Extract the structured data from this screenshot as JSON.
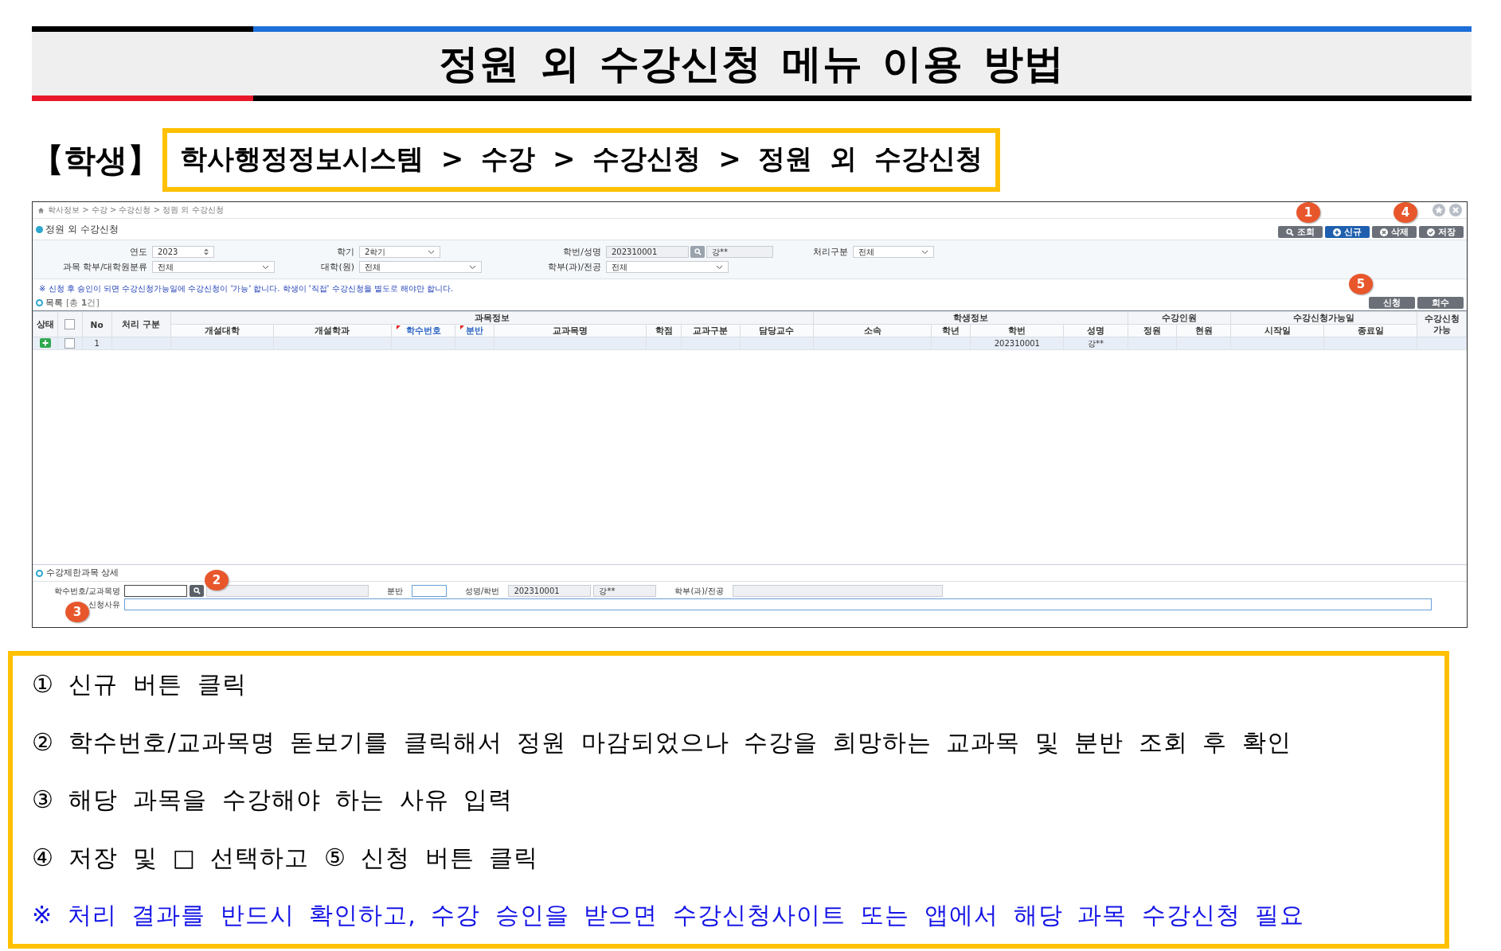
{
  "title": "정원 외 수강신청 메뉴 이용 방법",
  "role_label": "【학생】",
  "menu_path": "학사행정정보시스템 > 수강 > 수강신청 > 정원 외 수강신청",
  "screen": {
    "breadcrumb": "학사정보 > 수강 > 수강신청 > 정원 외 수강신청",
    "page_title": "정원 외 수강신청",
    "toolbar": [
      {
        "label": "조회",
        "highlighted": false
      },
      {
        "label": "신규",
        "highlighted": true
      },
      {
        "label": "삭제",
        "highlighted": false
      },
      {
        "label": "저장",
        "highlighted": false
      }
    ],
    "filters": [
      [
        {
          "label": "연도",
          "kind": "spinner",
          "value": "2023"
        },
        {
          "label": "학기",
          "kind": "select",
          "value": "2학기"
        },
        {
          "label": "학번/성명",
          "kind": "lookup",
          "value": "202310001",
          "name": "강**"
        },
        {
          "label": "처리구분",
          "kind": "select",
          "value": "전체"
        }
      ],
      [
        {
          "label": "과목 학부/대학원분류",
          "kind": "select",
          "value": "전체"
        },
        {
          "label": "대학(원)",
          "kind": "select",
          "value": "전체"
        },
        {
          "label": "학부(과)/전공",
          "kind": "select",
          "value": "전체"
        }
      ]
    ],
    "notice": "※ 신청 후 승인이 되면 수강신청가능일에 수강신청이 '가능' 합니다. 학생이 '직접' 수강신청을 별도로 해야만 합니다.",
    "list_title": "목록",
    "list_count": "[총 **1**건]",
    "list_buttons": [
      "신청",
      "회수"
    ],
    "table": {
      "lead_columns": [
        {
          "label": "상태",
          "kind": "status"
        },
        {
          "kind": "checkbox",
          "checked": false
        },
        {
          "label": "No",
          "kind": "text"
        },
        {
          "label": "처리 구분",
          "kind": "text"
        }
      ],
      "groups": [
        {
          "label": "과목정보",
          "columns": [
            {
              "label": "개설대학",
              "required": false
            },
            {
              "label": "개설학과",
              "required": false
            },
            {
              "label": "학수번호",
              "required": true
            },
            {
              "label": "분반",
              "required": true
            },
            {
              "label": "교과목명",
              "required": false
            },
            {
              "label": "학점",
              "required": false
            },
            {
              "label": "교과구분",
              "required": false
            },
            {
              "label": "담당교수",
              "required": false
            }
          ]
        },
        {
          "label": "학생정보",
          "columns": [
            {
              "label": "소속",
              "required": false
            },
            {
              "label": "학년",
              "required": false
            },
            {
              "label": "학번",
              "required": false
            },
            {
              "label": "성명",
              "required": false
            }
          ]
        },
        {
          "label": "수강인원",
          "columns": [
            {
              "label": "정원",
              "required": false
            },
            {
              "label": "현원",
              "required": false
            }
          ]
        },
        {
          "label": "수강신청가능일",
          "columns": [
            {
              "label": "시작일",
              "required": false
            },
            {
              "label": "종료일",
              "required": false
            }
          ]
        }
      ],
      "tail_columns": [
        {
          "label": "수강신청 가능"
        }
      ],
      "rows": [
        {
          "selected": true,
          "added": true,
          "checked": false,
          "no": "1",
          "student_id": "202310001",
          "name": "강**"
        }
      ]
    },
    "detail": {
      "title": "수강제한과목 상세",
      "rows": [
        [
          {
            "label": "학수번호/교과목명",
            "kind": "lookup"
          },
          {
            "label": "분반",
            "kind": "input"
          },
          {
            "label": "성명/학번",
            "kind": "pair",
            "value": "202310001",
            "name": "강**"
          },
          {
            "label": "학부(과)/전공",
            "kind": "readonly"
          }
        ],
        [
          {
            "label": "신청사유",
            "kind": "wide"
          }
        ]
      ]
    },
    "callouts": [
      "1",
      "4",
      "5",
      "2",
      "3"
    ]
  },
  "steps": [
    {
      "kind": "step",
      "text": "① 신규 버튼 클릭"
    },
    {
      "kind": "step",
      "text": "② 학수번호/교과목명 돋보기를 클릭해서 정원 마감되었으나 수강을 희망하는 교과목 및 분반 조회 후 확인"
    },
    {
      "kind": "step",
      "text": "③ 해당 과목을 수강해야 하는 사유 입력"
    },
    {
      "kind": "step",
      "text": "④ 저장 및 □ 선택하고 ⑤ 신청 버튼 클릭"
    },
    {
      "kind": "note",
      "text": "※ 처리 결과를 반드시 확인하고, 수강 승인을 받으면 수강신청사이트 또는 앱에서 해당 과목 수강신청 필요"
    }
  ]
}
